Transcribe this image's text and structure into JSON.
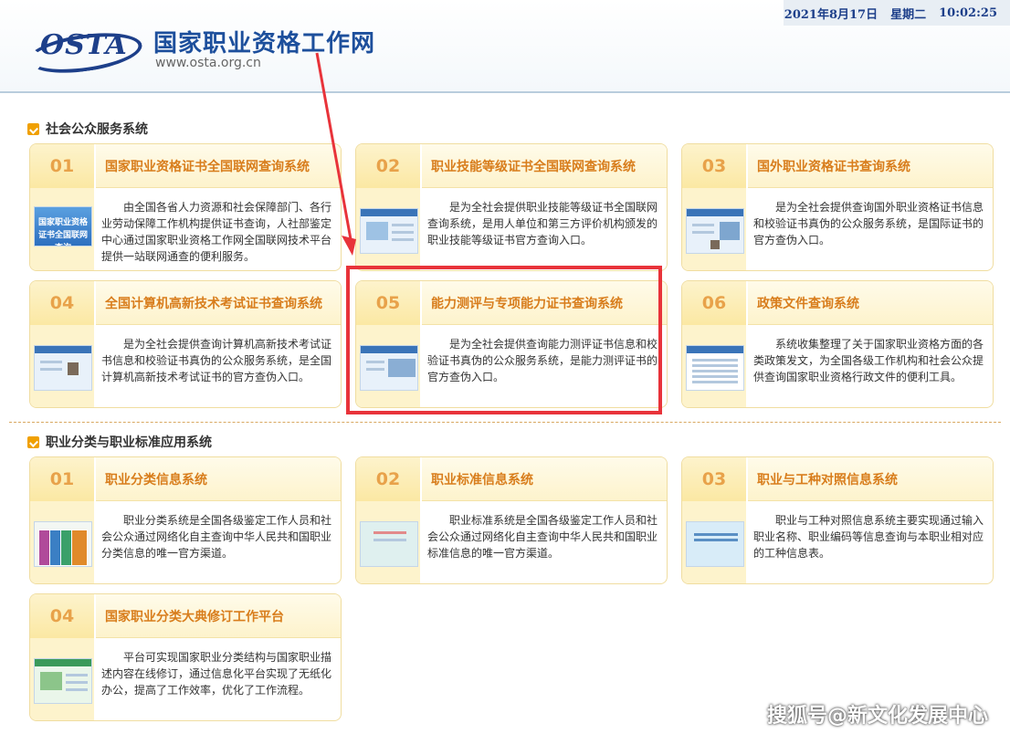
{
  "header": {
    "logo_text": "OSTA",
    "site_title": "国家职业资格工作网",
    "site_url": "www.osta.org.cn",
    "date": "2021年8月17日",
    "weekday": "星期二",
    "time": "10:02:25"
  },
  "sections": [
    {
      "title": "社会公众服务系统",
      "cards": [
        {
          "num": "01",
          "title": "国家职业资格证书全国联网查询系统",
          "desc": "由全国各省人力资源和社会保障部门、各行业劳动保障工作机构提供证书查询，人社部鉴定中心通过国家职业资格工作网全国联网技术平台提供一站联网通查的便利服务。",
          "thumb_text": "国家职业资格证书全国联网查询"
        },
        {
          "num": "02",
          "title": "职业技能等级证书全国联网查询系统",
          "desc": "是为全社会提供职业技能等级证书全国联网查询系统，是用人单位和第三方评价机构颁发的职业技能等级证书官方查询入口。"
        },
        {
          "num": "03",
          "title": "国外职业资格证书查询系统",
          "desc": "是为全社会提供查询国外职业资格证书信息和校验证书真伪的公众服务系统，是国际证书的官方查伪入口。"
        },
        {
          "num": "04",
          "title": "全国计算机高新技术考试证书查询系统",
          "desc": "是为全社会提供查询计算机高新技术考试证书信息和校验证书真伪的公众服务系统，是全国计算机高新技术考试证书的官方查伪入口。"
        },
        {
          "num": "05",
          "title": "能力测评与专项能力证书查询系统",
          "desc": "是为全社会提供查询能力测评证书信息和校验证书真伪的公众服务系统，是能力测评证书的官方查伪入口。"
        },
        {
          "num": "06",
          "title": "政策文件查询系统",
          "desc": "系统收集整理了关于国家职业资格方面的各类政策发文，为全国各级工作机构和社会公众提供查询国家职业资格行政文件的便利工具。"
        }
      ]
    },
    {
      "title": "职业分类与职业标准应用系统",
      "cards": [
        {
          "num": "01",
          "title": "职业分类信息系统",
          "desc": "职业分类系统是全国各级鉴定工作人员和社会公众通过网络化自主查询中华人民共和国职业分类信息的唯一官方渠道。"
        },
        {
          "num": "02",
          "title": "职业标准信息系统",
          "desc": "职业标准系统是全国各级鉴定工作人员和社会公众通过网络化自主查询中华人民共和国职业标准信息的唯一官方渠道。"
        },
        {
          "num": "03",
          "title": "职业与工种对照信息系统",
          "desc": "职业与工种对照信息系统主要实现通过输入职业名称、职业编码等信息查询与本职业相对应的工种信息表。"
        },
        {
          "num": "04",
          "title": "国家职业分类大典修订工作平台",
          "desc": "平台可实现国家职业分类结构与国家职业描述内容在线修订，通过信息化平台实现了无纸化办公，提高了工作效率，优化了工作流程。"
        }
      ]
    }
  ],
  "watermark": "搜狐号@新文化发展中心",
  "colors": {
    "accent": "#d87d1c",
    "brand": "#1d4f9c",
    "highlight": "#e8333a",
    "number": "#e8a24a"
  }
}
